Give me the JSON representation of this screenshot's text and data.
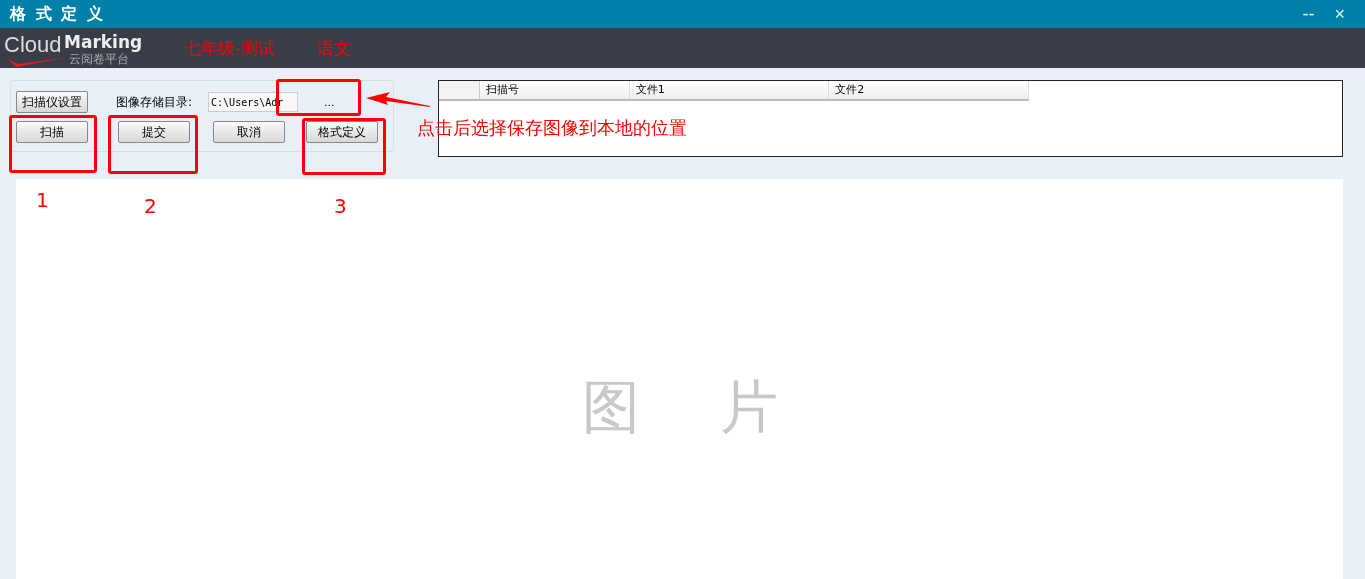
{
  "window": {
    "title": "格 式 定 义",
    "controls": [
      "--",
      "×"
    ]
  },
  "header": {
    "logo": {
      "word1": "Cloud",
      "word2": "Marking",
      "subtitle": "云阅卷平台"
    },
    "exam": "七年级-测试",
    "subject": "语文"
  },
  "panel": {
    "buttons_top": [
      "扫描仪设置"
    ],
    "dir_label": "图像存储目录:",
    "dir_value": "C:\\Users\\Adr",
    "browse": "...",
    "buttons": [
      "扫描",
      "提交",
      "取消",
      "格式定义"
    ]
  },
  "table": {
    "columns": [
      "扫描号",
      "文件1",
      "文件2"
    ]
  },
  "preview": {
    "kind": "placeholder",
    "chars": [
      "图",
      "片"
    ]
  },
  "annotations": {
    "note": "点击后选择保存图像到本地的位置",
    "numbers": [
      "1",
      "2",
      "3"
    ]
  }
}
